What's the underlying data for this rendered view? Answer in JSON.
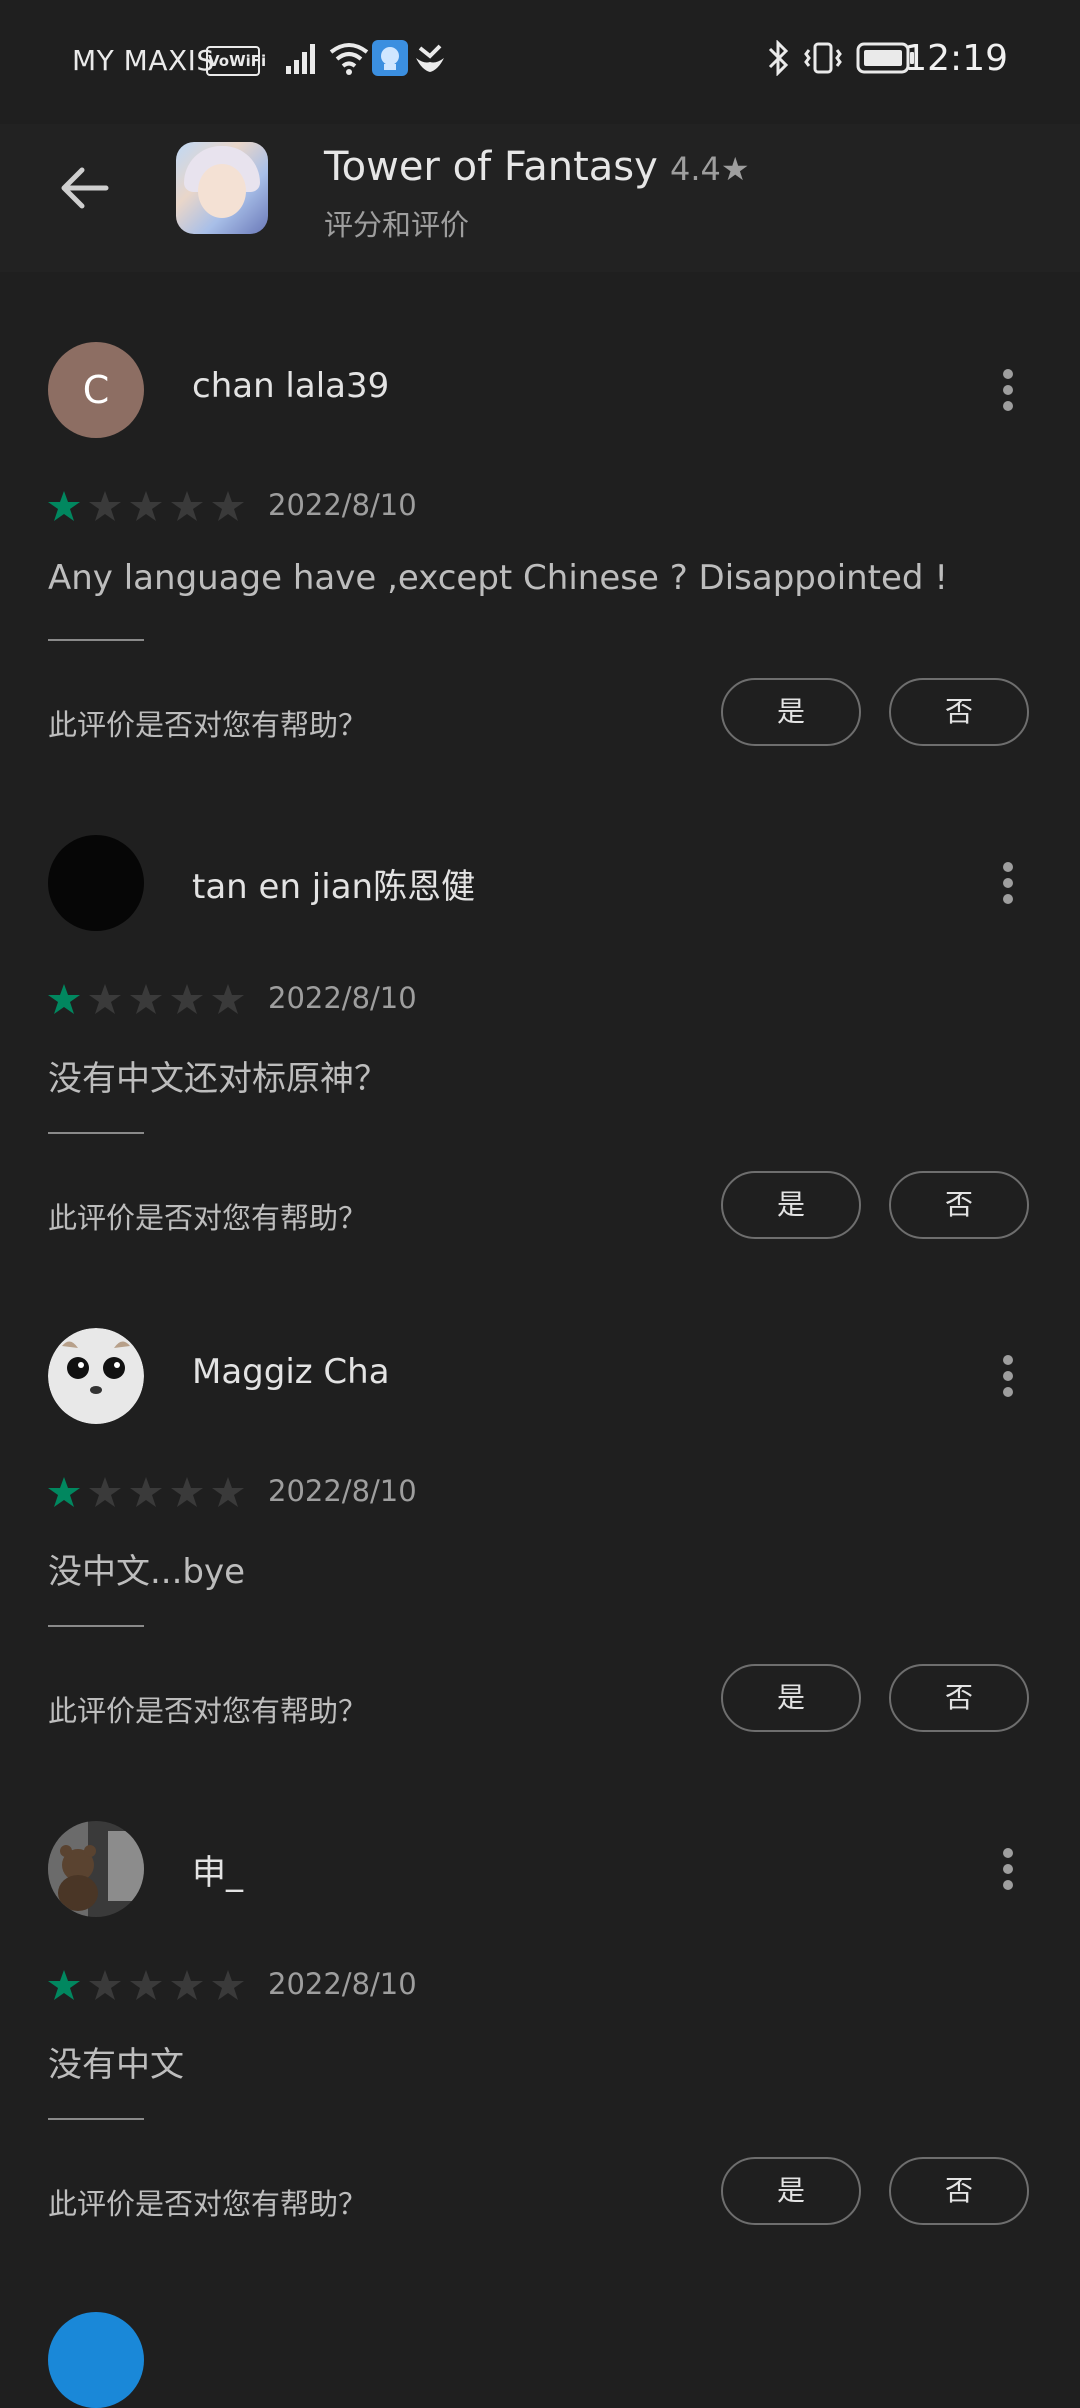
{
  "status_bar": {
    "carrier": "MY MAXIS",
    "vowifi": "VoWiFi",
    "time": "12:19"
  },
  "header": {
    "app_title": "Tower of Fantasy",
    "rating": "4.4★",
    "subtitle": "评分和评价"
  },
  "colors": {
    "background": "#1f1f1f",
    "star_filled": "#01875f",
    "star_empty": "#3a3a3a"
  },
  "reviews": [
    {
      "author": "chan lala39",
      "avatar_letter": "C",
      "stars": 1,
      "date": "2022/8/10",
      "text": "Any language have ,except Chinese ? Disappointed !",
      "helpful_prompt": "此评价是否对您有帮助？",
      "yes": "是",
      "no": "否"
    },
    {
      "author": "tan en jian陈恩健",
      "avatar_letter": "",
      "stars": 1,
      "date": "2022/8/10",
      "text": "没有中文还对标原神？",
      "helpful_prompt": "此评价是否对您有帮助？",
      "yes": "是",
      "no": "否"
    },
    {
      "author": "Maggiz Cha",
      "avatar_letter": "",
      "stars": 1,
      "date": "2022/8/10",
      "text": "没中文...bye",
      "helpful_prompt": "此评价是否对您有帮助？",
      "yes": "是",
      "no": "否"
    },
    {
      "author": "申_",
      "avatar_letter": "",
      "stars": 1,
      "date": "2022/8/10",
      "text": "没有中文",
      "helpful_prompt": "此评价是否对您有帮助？",
      "yes": "是",
      "no": "否"
    }
  ]
}
